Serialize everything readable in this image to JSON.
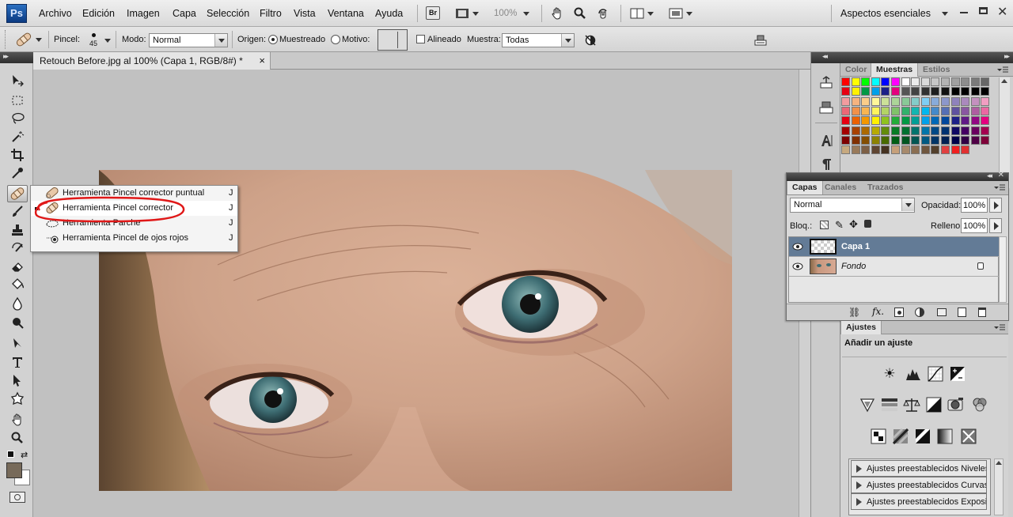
{
  "app": {
    "logo": "Ps"
  },
  "menu": [
    "Archivo",
    "Edición",
    "Imagen",
    "Capa",
    "Selección",
    "Filtro",
    "Vista",
    "Ventana",
    "Ayuda"
  ],
  "menubar": {
    "bridge_label": "Br",
    "zoom": "100%",
    "workspace": "Aspectos esenciales"
  },
  "options": {
    "brush_label": "Pincel:",
    "brush_size": "45",
    "mode_label": "Modo:",
    "mode_value": "Normal",
    "source_label": "Origen:",
    "sampled_label": "Muestreado",
    "pattern_label": "Motivo:",
    "aligned_label": "Alineado",
    "sample_label": "Muestra:",
    "sample_value": "Todas"
  },
  "document": {
    "tab_title": "Retouch Before.jpg al 100% (Capa 1, RGB/8#) *",
    "close": "×"
  },
  "flyout": {
    "items": [
      {
        "label": "Herramienta Pincel corrector puntual",
        "key": "J"
      },
      {
        "label": "Herramienta Pincel corrector",
        "key": "J"
      },
      {
        "label": "Herramienta Parche",
        "key": "J"
      },
      {
        "label": "Herramienta Pincel de ojos rojos",
        "key": "J"
      }
    ]
  },
  "swatches_panel": {
    "tabs": [
      "Color",
      "Muestras",
      "Estilos"
    ],
    "active": "Muestras"
  },
  "layers_panel": {
    "tabs": [
      "Capas",
      "Canales",
      "Trazados"
    ],
    "blend_mode": "Normal",
    "opacity_label": "Opacidad:",
    "opacity_value": "100%",
    "lock_label": "Bloq.:",
    "fill_label": "Relleno:",
    "fill_value": "100%",
    "layers": [
      {
        "name": "Capa 1",
        "selected": true
      },
      {
        "name": "Fondo",
        "selected": false
      }
    ]
  },
  "adjustments_panel": {
    "tab": "Ajustes",
    "title": "Añadir un ajuste",
    "presets": [
      "Ajustes preestablecidos Niveles",
      "Ajustes preestablecidos Curvas",
      "Ajustes preestablecidos Exposici..."
    ]
  },
  "colors": {
    "foreground": "#776a5a",
    "background": "#ffffff",
    "accent_blue": "#637b96",
    "annotation_red": "#e01818"
  }
}
